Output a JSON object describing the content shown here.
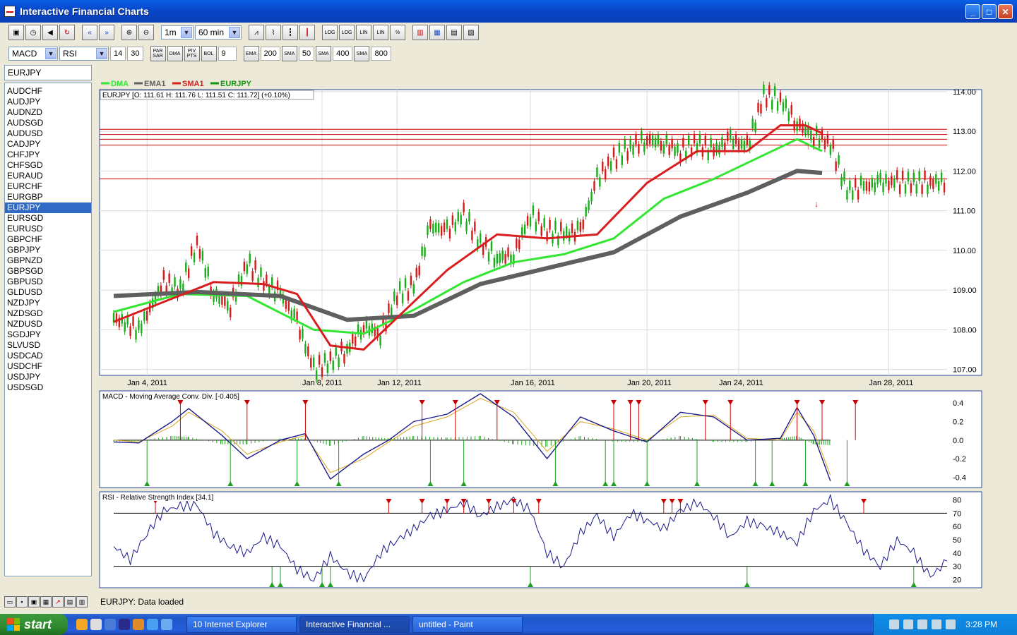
{
  "window": {
    "title": "Interactive Financial Charts"
  },
  "toolbar1": {
    "period": "1m",
    "interval": "60 min",
    "indicator_buttons": [
      "LOG",
      "LOG",
      "LIN",
      "LIN",
      "%"
    ]
  },
  "toolbar2": {
    "indicator1": "MACD",
    "indicator2": "RSI",
    "p1": "14",
    "p2": "30",
    "par_sar": "PAR SAR",
    "dma": "DMA",
    "piv_pts": "PIV PTS",
    "bol": "BOL",
    "bol_val": "9",
    "ema": "EMA",
    "ema_val": "200",
    "sma1": "SMA",
    "sma1_val": "50",
    "sma2": "SMA",
    "sma2_val": "400",
    "sma3": "SMA",
    "sma3_val": "800"
  },
  "sidebar": {
    "current_symbol": "EURJPY",
    "symbols": [
      "AUDCHF",
      "AUDJPY",
      "AUDNZD",
      "AUDSGD",
      "AUDUSD",
      "CADJPY",
      "CHFJPY",
      "CHFSGD",
      "EURAUD",
      "EURCHF",
      "EURGBP",
      "EURJPY",
      "EURSGD",
      "EURUSD",
      "GBPCHF",
      "GBPJPY",
      "GBPNZD",
      "GBPSGD",
      "GBPUSD",
      "GLDUSD",
      "NZDJPY",
      "NZDSGD",
      "NZDUSD",
      "SGDJPY",
      "SLVUSD",
      "USDCAD",
      "USDCHF",
      "USDJPY",
      "USDSGD"
    ],
    "active_index": 11
  },
  "status": {
    "text": "EURJPY: Data loaded"
  },
  "chart_data": [
    {
      "type": "line",
      "legend": [
        "DMA",
        "EMA1",
        "SMA1",
        "EURJPY"
      ],
      "legend_colors": [
        "#32e632",
        "#5f5f5f",
        "#d81e1e",
        "#119611"
      ],
      "info": "EURJPY [O: 111.61  H: 111.76  L: 111.51  C: 111.72] (+0.10%)",
      "x_labels": [
        "Jan 4, 2011",
        "Jan 8, 2011",
        "Jan 12, 2011",
        "Jan 16, 2011",
        "Jan 20, 2011",
        "Jan 24, 2011",
        "Jan 28, 2011"
      ],
      "y_ticks": [
        "114.00",
        "113.00",
        "112.00",
        "111.00",
        "110.00",
        "109.00",
        "108.00",
        "107.00"
      ],
      "ylim": [
        106.85,
        114.05
      ],
      "hlines": [
        113.05,
        112.92,
        112.8,
        112.65,
        111.8
      ],
      "hline_color": "#cc0000",
      "grid": true,
      "price_x": [
        0,
        3,
        6,
        8,
        10,
        12,
        14,
        16,
        18,
        20,
        22,
        24,
        26,
        28,
        30,
        32,
        34,
        36,
        38,
        40,
        42,
        44,
        46,
        48,
        50,
        52,
        54,
        56,
        58,
        60,
        62,
        64,
        66,
        68,
        70,
        72,
        74,
        76,
        78,
        80,
        82,
        84,
        86,
        88,
        90,
        92,
        94,
        96,
        98,
        100
      ],
      "price": [
        108.3,
        108.0,
        109.2,
        109.0,
        110.2,
        108.9,
        108.6,
        109.7,
        109.2,
        108.9,
        108.2,
        107.0,
        107.2,
        107.5,
        108.1,
        107.9,
        108.9,
        109.1,
        110.6,
        110.5,
        110.9,
        110.2,
        109.8,
        109.9,
        110.9,
        110.5,
        110.4,
        110.5,
        111.8,
        112.3,
        112.6,
        112.8,
        112.7,
        112.5,
        112.7,
        112.5,
        112.8,
        112.6,
        113.9,
        113.8,
        113.2,
        112.9,
        112.7,
        111.5,
        111.6,
        111.7,
        111.72,
        111.7,
        111.72,
        111.72
      ],
      "series": [
        {
          "name": "DMA",
          "color": "#32e632",
          "x": [
            0,
            8,
            16,
            24,
            30,
            36,
            42,
            48,
            54,
            60,
            66,
            72,
            78,
            82,
            85
          ],
          "values": [
            108.45,
            108.9,
            108.85,
            108.0,
            107.9,
            108.5,
            109.2,
            109.7,
            109.9,
            110.3,
            111.3,
            111.8,
            112.4,
            112.8,
            112.5
          ]
        },
        {
          "name": "EMA1",
          "color": "#5f5f5f",
          "x": [
            0,
            10,
            20,
            28,
            36,
            44,
            52,
            60,
            68,
            76,
            82,
            85
          ],
          "values": [
            108.85,
            108.95,
            108.85,
            108.25,
            108.35,
            109.15,
            109.55,
            109.95,
            110.85,
            111.45,
            112.0,
            111.95
          ]
        },
        {
          "name": "SMA1",
          "color": "#d81e1e",
          "x": [
            0,
            6,
            12,
            18,
            22,
            26,
            30,
            34,
            40,
            46,
            52,
            58,
            64,
            70,
            76,
            80,
            83,
            85
          ],
          "values": [
            108.2,
            108.7,
            109.2,
            109.15,
            108.9,
            107.6,
            107.5,
            108.3,
            109.5,
            110.4,
            110.3,
            110.4,
            111.7,
            112.5,
            112.5,
            113.15,
            113.15,
            112.95
          ]
        }
      ]
    },
    {
      "type": "line",
      "title": "MACD - Moving Average Conv. Div. [-0.405]",
      "y_ticks": [
        "0.4",
        "0.2",
        "0.0",
        "-0.2",
        "-0.4"
      ],
      "ylim": [
        -0.48,
        0.5
      ],
      "x": [
        0,
        3,
        7,
        9,
        13,
        16,
        20,
        23,
        26,
        30,
        33,
        36,
        40,
        44,
        48,
        52,
        56,
        60,
        64,
        68,
        72,
        76,
        80,
        82,
        84,
        86
      ],
      "macd": [
        -0.02,
        -0.03,
        0.2,
        0.34,
        0.05,
        -0.2,
        0.0,
        0.07,
        -0.42,
        -0.15,
        0.0,
        0.2,
        0.28,
        0.5,
        0.25,
        -0.2,
        0.25,
        0.1,
        -0.02,
        0.3,
        0.25,
        0.0,
        0.02,
        0.35,
        0.05,
        -0.44
      ],
      "signal": [
        0.0,
        -0.02,
        0.15,
        0.3,
        0.1,
        -0.15,
        -0.02,
        0.05,
        -0.35,
        -0.2,
        -0.02,
        0.15,
        0.25,
        0.45,
        0.3,
        -0.12,
        0.2,
        0.12,
        0.0,
        0.25,
        0.27,
        0.02,
        0.0,
        0.3,
        0.1,
        -0.38
      ],
      "sell_signals": [
        8,
        16,
        23,
        37,
        41,
        46,
        60,
        62,
        63,
        71,
        74,
        82,
        85,
        89
      ],
      "buy_signals": [
        4,
        14,
        22,
        27,
        38,
        42,
        53,
        59,
        60,
        64,
        70,
        77,
        79,
        83,
        88
      ]
    },
    {
      "type": "line",
      "title": "RSI - Relative Strength Index [34.1]",
      "y_ticks": [
        "80",
        "70",
        "60",
        "50",
        "40",
        "30",
        "20"
      ],
      "ylim": [
        16,
        84
      ],
      "levels": [
        70,
        30
      ],
      "x": [
        0,
        2,
        4,
        6,
        8,
        10,
        12,
        14,
        16,
        18,
        20,
        22,
        24,
        26,
        28,
        30,
        32,
        34,
        36,
        38,
        40,
        42,
        44,
        46,
        48,
        50,
        52,
        54,
        56,
        58,
        60,
        62,
        64,
        66,
        68,
        70,
        72,
        74,
        76,
        78,
        80,
        82,
        84,
        86,
        88,
        90,
        92,
        94,
        96,
        98,
        100
      ],
      "values": [
        45,
        35,
        55,
        72,
        75,
        76,
        55,
        45,
        40,
        52,
        45,
        28,
        20,
        38,
        25,
        20,
        40,
        50,
        58,
        68,
        72,
        78,
        68,
        75,
        80,
        72,
        40,
        30,
        55,
        68,
        52,
        70,
        65,
        58,
        72,
        78,
        68,
        52,
        64,
        60,
        55,
        48,
        72,
        80,
        62,
        42,
        30,
        50,
        40,
        22,
        34
      ],
      "overbought_signals": [
        5,
        33,
        37,
        40,
        42,
        45,
        48,
        51,
        66,
        67,
        68,
        90
      ],
      "oversold_signals": [
        19,
        20,
        25,
        26,
        50,
        76,
        96
      ]
    }
  ],
  "taskbar": {
    "start": "start",
    "tasks": [
      "10 Internet Explorer",
      "Interactive Financial ...",
      "untitled - Paint"
    ],
    "clock": "3:28 PM"
  }
}
